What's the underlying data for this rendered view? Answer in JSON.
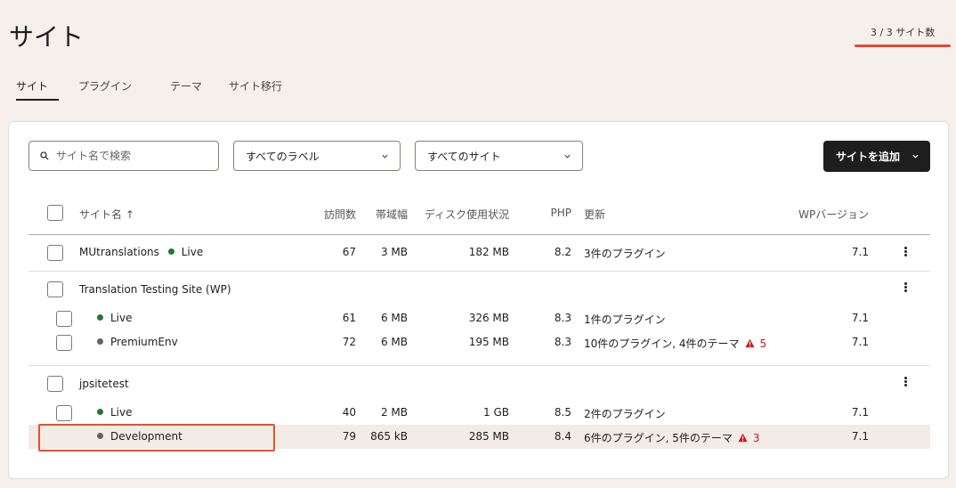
{
  "header": {
    "title": "サイト",
    "site_count": "3 / 3 サイト数"
  },
  "tabs": [
    {
      "label": "サイト",
      "active": true
    },
    {
      "label": "プラグイン",
      "active": false
    },
    {
      "label": "テーマ",
      "active": false
    },
    {
      "label": "サイト移行",
      "active": false
    }
  ],
  "toolbar": {
    "search_placeholder": "サイト名で検索",
    "label_filter": "すべてのラベル",
    "site_filter": "すべてのサイト",
    "add_button": "サイトを追加"
  },
  "table": {
    "headers": {
      "name": "サイト名 ↑",
      "visits": "訪問数",
      "bandwidth": "帯域幅",
      "disk": "ディスク使用状況",
      "php": "PHP",
      "updates": "更新",
      "wp": "WPバージョン"
    },
    "groups": [
      {
        "name": "MUtranslations",
        "env": "Live",
        "visits": "67",
        "bandwidth": "3 MB",
        "disk": "182 MB",
        "php": "8.2",
        "updates": "3件のプラグイン",
        "wp": "7.1"
      },
      {
        "name": "Translation Testing Site (WP)",
        "envs": [
          {
            "env": "Live",
            "visits": "61",
            "bandwidth": "6 MB",
            "disk": "326 MB",
            "php": "8.3",
            "updates": "1件のプラグイン",
            "warn": "",
            "wp": "7.1"
          },
          {
            "env": "PremiumEnv",
            "visits": "72",
            "bandwidth": "6 MB",
            "disk": "195 MB",
            "php": "8.3",
            "updates": "10件のプラグイン, 4件のテーマ",
            "warn": "5",
            "wp": "7.1"
          }
        ]
      },
      {
        "name": "jpsitetest",
        "envs": [
          {
            "env": "Live",
            "visits": "40",
            "bandwidth": "2 MB",
            "disk": "1 GB",
            "php": "8.5",
            "updates": "2件のプラグイン",
            "warn": "",
            "wp": "7.1"
          },
          {
            "env": "Development",
            "visits": "79",
            "bandwidth": "865 kB",
            "disk": "285 MB",
            "php": "8.4",
            "updates": "6件のプラグイン, 5件のテーマ",
            "warn": "3",
            "wp": "7.1"
          }
        ]
      }
    ]
  },
  "colors": {
    "background": "#f5f0ec",
    "live": "#1f7a3a",
    "non_live": "#6b5f58",
    "warning": "#cc1818",
    "primary_button": "#1e1e1e",
    "annotation": "#e8472b"
  }
}
